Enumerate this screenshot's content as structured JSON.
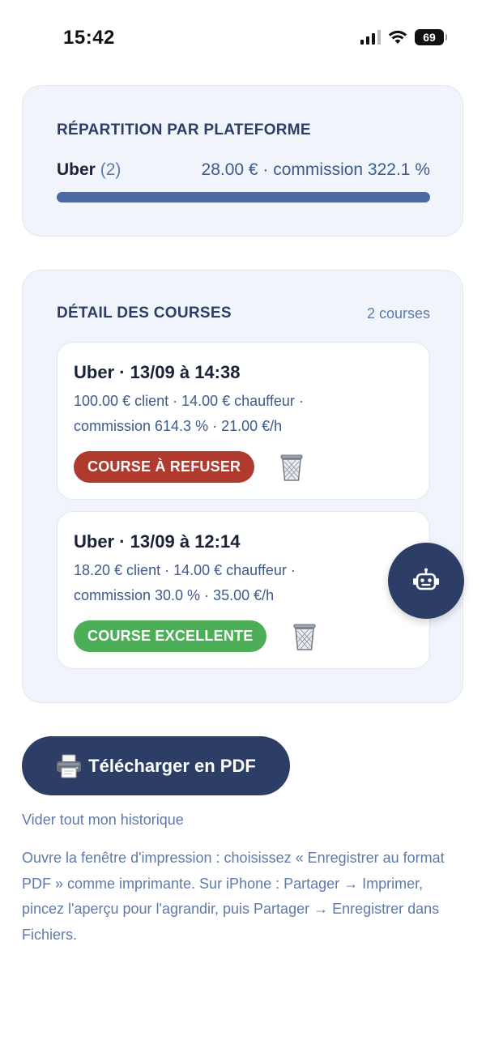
{
  "status_bar": {
    "time": "15:42",
    "battery": "69",
    "icons": [
      "signal-icon",
      "wifi-icon",
      "battery-icon"
    ]
  },
  "platform_section": {
    "title": "RÉPARTITION PAR PLATEFORME",
    "rows": [
      {
        "name": "Uber",
        "count": "(2)",
        "stats": "28.00 € · commission 322.1 %",
        "share": 1.0
      }
    ]
  },
  "detail_section": {
    "title": "DÉTAIL DES COURSES",
    "count": "2 courses",
    "courses": [
      {
        "title": "Uber · 13/09 à 14:38",
        "line1": "100.00 € client · 14.00 € chauffeur ·",
        "line2": "commission 614.3 % · 21.00 €/h",
        "badge": "COURSE À REFUSER",
        "badge_color": "#b03a2e",
        "delete_icon": "trash-icon"
      },
      {
        "title": "Uber · 13/09 à 12:14",
        "line1": "18.20 € client · 14.00 € chauffeur ·",
        "line2": "commission 30.0 % · 35.00 €/h",
        "badge": "COURSE EXCELLENTE",
        "badge_color": "#4cae57",
        "delete_icon": "trash-icon"
      }
    ]
  },
  "fab": {
    "icon": "robot-icon"
  },
  "actions": {
    "pdf_icon": "printer-icon",
    "pdf_label": "Télécharger en PDF",
    "clear_history": "Vider tout mon historique",
    "help_text": "Ouvre la fenêtre d'impression : choisissez « Enregistrer au format PDF » comme imprimante. Sur iPhone : Partager → Imprimer, pincez l'aperçu pour l'agrandir, puis Partager → Enregistrer dans Fichiers."
  },
  "colors": {
    "primary": "#2c3e66",
    "accent_text": "#5d7aaa",
    "card_bg": "#f1f5fb",
    "progress": "#4a6aa5",
    "danger": "#b03a2e",
    "success": "#4cae57"
  }
}
